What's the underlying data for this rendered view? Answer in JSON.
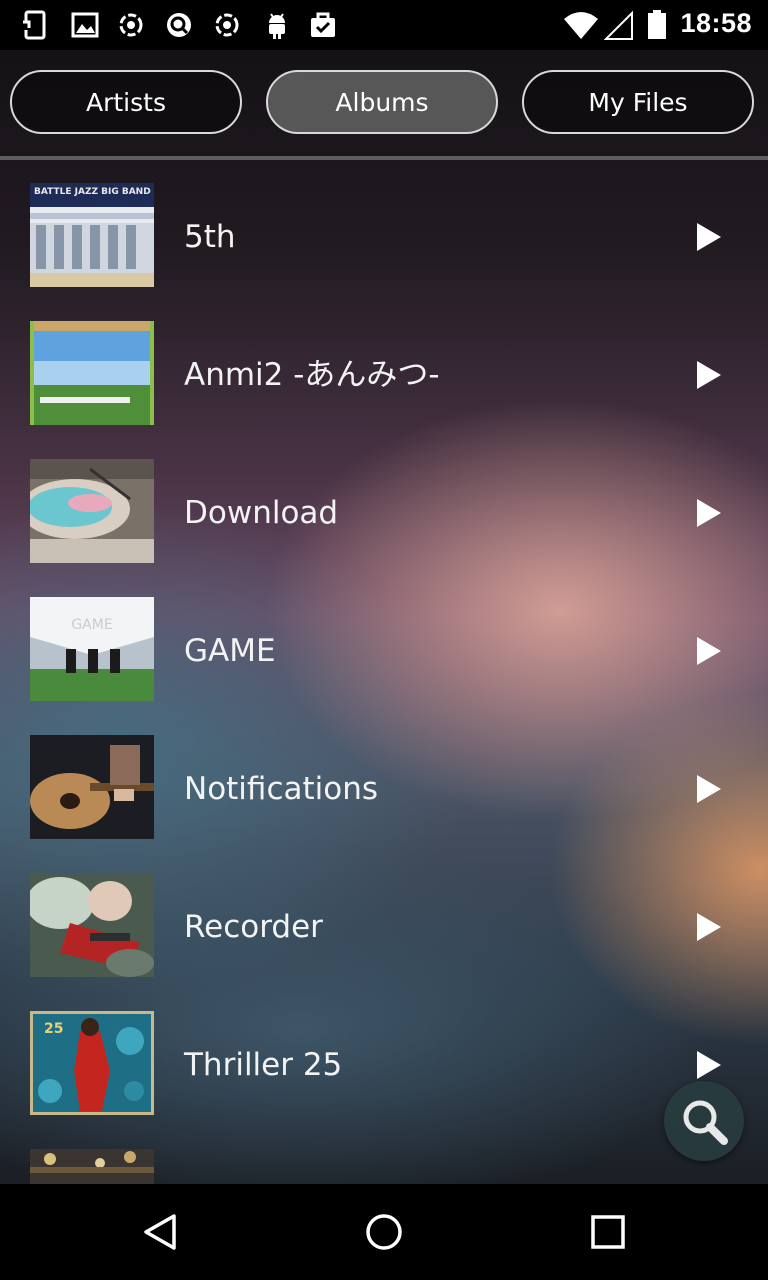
{
  "status_bar": {
    "time": "18:58",
    "left_icons": [
      "screenshot-icon",
      "image-icon",
      "sync-icon",
      "quick-icon",
      "sync-icon",
      "android-icon",
      "briefcase-check-icon"
    ],
    "right_icons": [
      "wifi-icon",
      "cell-signal-icon",
      "battery-icon"
    ]
  },
  "tabs": [
    {
      "label": "Artists",
      "active": false
    },
    {
      "label": "Albums",
      "active": true
    },
    {
      "label": "My Files",
      "active": false
    }
  ],
  "albums": [
    {
      "title": "5th",
      "cover_text": "BATTLE JAZZ BIG BAND"
    },
    {
      "title": "Anmi2 -あんみつ-"
    },
    {
      "title": "Download"
    },
    {
      "title": "GAME",
      "cover_text": "GAME"
    },
    {
      "title": "Notifications"
    },
    {
      "title": "Recorder"
    },
    {
      "title": "Thriller 25",
      "cover_text": "25"
    }
  ],
  "fab": {
    "icon": "search-icon"
  },
  "nav": {
    "icons": [
      "back-icon",
      "home-icon",
      "recents-icon"
    ]
  },
  "colors": {
    "status_bar": "#000000",
    "tab_border": "#d9d9d9",
    "active_tab": "#6e6e6e"
  }
}
